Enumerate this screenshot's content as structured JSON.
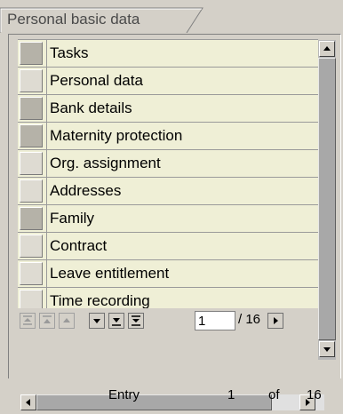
{
  "tab": {
    "title": "Personal basic data"
  },
  "list": {
    "items": [
      {
        "label": "Tasks",
        "shaded": true
      },
      {
        "label": "Personal data",
        "shaded": false
      },
      {
        "label": "Bank details",
        "shaded": true
      },
      {
        "label": "Maternity protection",
        "shaded": true
      },
      {
        "label": "Org. assignment",
        "shaded": false
      },
      {
        "label": "Addresses",
        "shaded": false
      },
      {
        "label": "Family",
        "shaded": true
      },
      {
        "label": "Contract",
        "shaded": false
      },
      {
        "label": "Leave entitlement",
        "shaded": false
      },
      {
        "label": "Time recording",
        "shaded": false
      }
    ]
  },
  "pager": {
    "current_page": "1",
    "total_label": "/ 16"
  },
  "footer": {
    "entry_label": "Entry",
    "entry_value": "1",
    "of_label": "of",
    "total": "16"
  },
  "colors": {
    "row_bg": "#efefd6",
    "panel_bg": "#d4d0c8",
    "scroll_track": "#b8b8b8"
  },
  "icons": [
    "scroll-up-arrow-icon",
    "scroll-down-arrow-icon",
    "scroll-left-arrow-icon",
    "scroll-right-arrow-icon",
    "first-page-icon",
    "previous-page-icon",
    "page-up-icon",
    "page-down-icon",
    "next-page-icon",
    "last-page-icon",
    "next-arrow-icon"
  ]
}
